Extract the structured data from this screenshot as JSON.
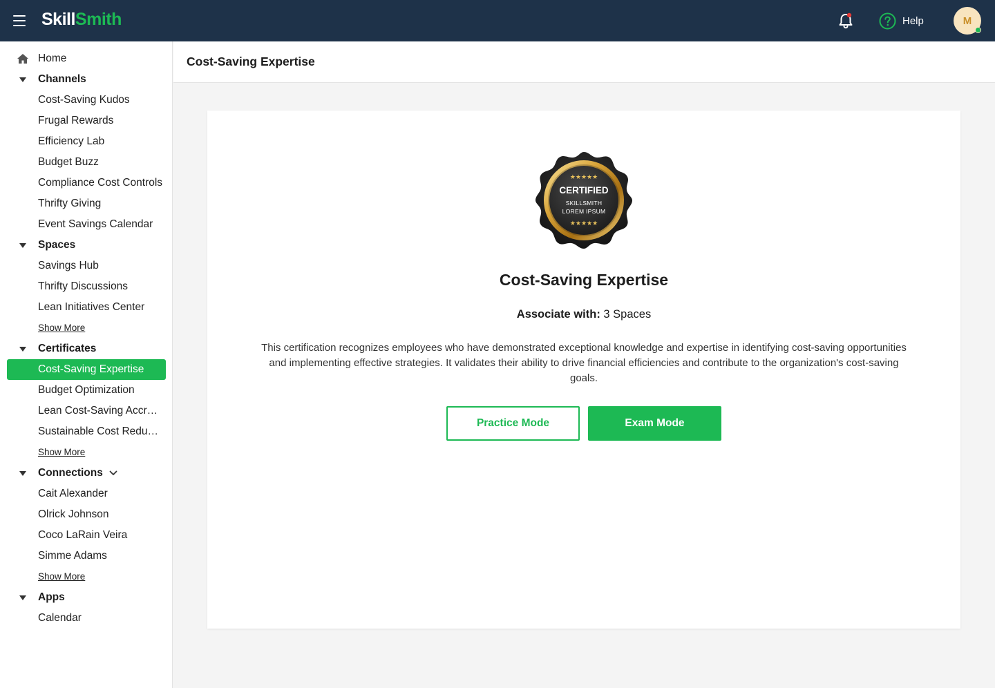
{
  "app": {
    "logo_part1": "Skill",
    "logo_part2": "Smith",
    "brand_color": "#1db954",
    "topbar_color": "#1e3249"
  },
  "topbar": {
    "help_label": "Help",
    "avatar_initial": "M",
    "notification_icon": "bell-icon",
    "help_icon": "question-circle-icon"
  },
  "sidebar": {
    "home": "Home",
    "channels": {
      "label": "Channels",
      "items": [
        "Cost-Saving Kudos",
        "Frugal Rewards",
        "Efficiency Lab",
        "Budget Buzz",
        "Compliance Cost Controls",
        "Thrifty Giving",
        "Event Savings Calendar"
      ]
    },
    "spaces": {
      "label": "Spaces",
      "items": [
        "Savings Hub",
        "Thrifty Discussions",
        "Lean Initiatives Center"
      ],
      "show_more": "Show More"
    },
    "certificates": {
      "label": "Certificates",
      "items": [
        "Cost-Saving Expertise",
        "Budget Optimization",
        "Lean Cost-Saving Accreditation",
        "Sustainable Cost Reduction"
      ],
      "active": "Cost-Saving Expertise",
      "show_more": "Show More"
    },
    "connections": {
      "label": "Connections",
      "items": [
        "Cait Alexander",
        "Olrick Johnson",
        "Coco LaRain Veira",
        "Simme Adams"
      ],
      "show_more": "Show More"
    },
    "apps": {
      "label": "Apps",
      "items": [
        "Calendar"
      ]
    }
  },
  "page": {
    "title": "Cost-Saving Expertise"
  },
  "certificate": {
    "badge": {
      "title": "CERTIFIED",
      "line1": "SKILLSMITH",
      "line2": "LOREM IPSUM",
      "stars": "★★★★★"
    },
    "name": "Cost-Saving Expertise",
    "associate_label": "Associate with:",
    "associate_value": "3 Spaces",
    "description": "This certification recognizes employees who have demonstrated exceptional knowledge and expertise in identifying cost-saving opportunities and implementing effective strategies. It validates their ability to drive financial efficiencies and contribute to the organization's cost-saving goals.",
    "practice_button": "Practice Mode",
    "exam_button": "Exam Mode"
  }
}
